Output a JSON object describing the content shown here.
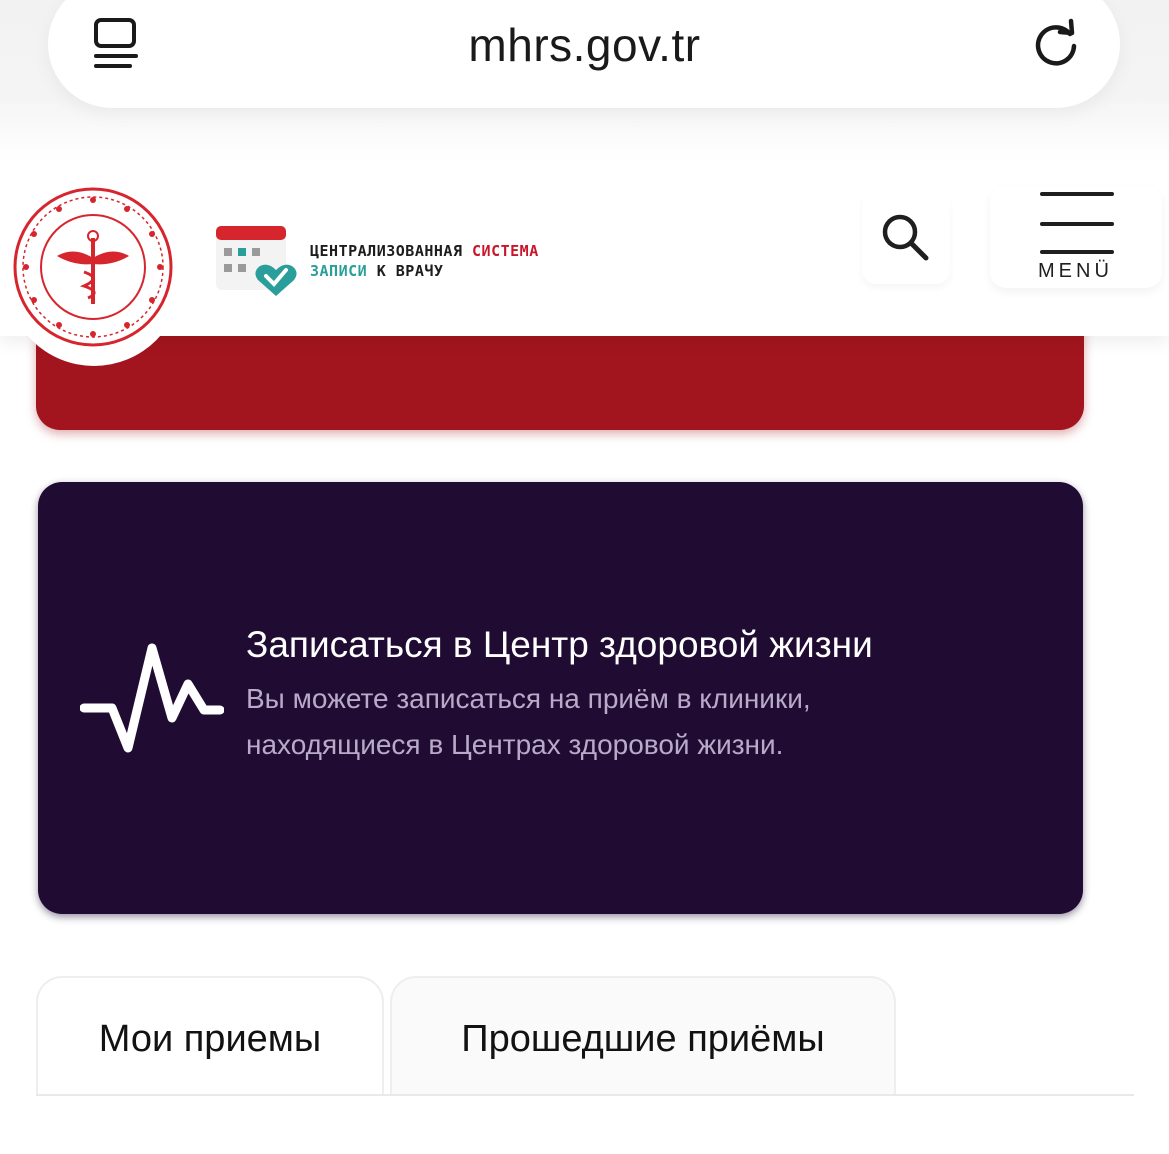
{
  "browser": {
    "url": "mhrs.gov.tr"
  },
  "header": {
    "brand_line1_dark": "ЦЕНТРАЛИЗОВАННАЯ",
    "brand_line1_red": "СИСТЕМА",
    "brand_line2_teal": "ЗАПИСИ",
    "brand_line2_dark": "К ВРАЧУ",
    "menu_label": "MENÜ"
  },
  "cards": {
    "healthy_life": {
      "title": "Записаться в Центр здоровой жизни",
      "description": "Вы можете записаться на приём в клиники, находящиеся в Центрах здоровой жизни."
    }
  },
  "tabs": [
    {
      "label": "Мои приемы",
      "active": true
    },
    {
      "label": "Прошедшие приёмы",
      "active": false
    }
  ],
  "colors": {
    "red_card": "#a3151e",
    "purple_card": "#200c33",
    "brand_red": "#c9162b",
    "brand_teal": "#2a9e9a"
  },
  "icons": {
    "tabs": "tabs-icon",
    "reload": "reload-icon",
    "seal": "ministry-seal-icon",
    "brand": "calendar-heart-icon",
    "search": "search-icon",
    "menu": "hamburger-icon",
    "pulse": "heartbeat-icon"
  }
}
